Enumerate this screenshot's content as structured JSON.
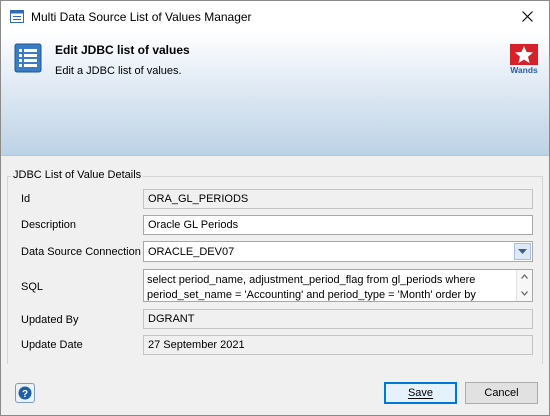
{
  "window": {
    "title": "Multi Data Source List of Values Manager"
  },
  "banner": {
    "heading": "Edit JDBC list of values",
    "subheading": "Edit a JDBC list of values.",
    "logo_text": "Wands",
    "logo_color": "#d6202a",
    "logo_text_color": "#2a5db0"
  },
  "group": {
    "label": "JDBC List of Value Details"
  },
  "form": {
    "id": {
      "label": "Id",
      "value": "ORA_GL_PERIODS"
    },
    "description": {
      "label": "Description",
      "value": "Oracle GL Periods"
    },
    "connection": {
      "label": "Data Source Connection",
      "value": "ORACLE_DEV07"
    },
    "sql": {
      "label": "SQL",
      "value": "select period_name, adjustment_period_flag from gl_periods where\nperiod_set_name = 'Accounting' and period_type = 'Month' order by"
    },
    "updated_by": {
      "label": "Updated By",
      "value": "DGRANT"
    },
    "update_date": {
      "label": "Update Date",
      "value": "27 September 2021"
    }
  },
  "buttons": {
    "save": "Save",
    "cancel": "Cancel",
    "help": "?"
  },
  "colors": {
    "accent": "#0078d7",
    "banner_bottom": "#bcd2e6",
    "help_blue": "#1f5fa8"
  }
}
